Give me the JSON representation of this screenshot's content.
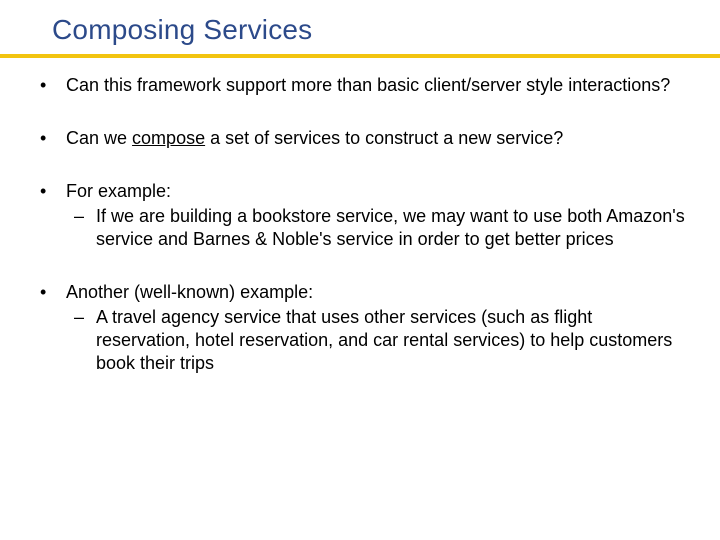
{
  "title": "Composing Services",
  "bullets": {
    "b1": "Can this framework support more than basic client/server style interactions?",
    "b2_pre": "Can we ",
    "b2_u": "compose",
    "b2_post": " a set of services to construct a new service?",
    "b3": "For example:",
    "b3_sub": "If we are building a bookstore service, we may want to use both Amazon's service and Barnes & Noble's service in order to get better prices",
    "b4": "Another (well-known) example:",
    "b4_sub": "A travel agency service that uses other services (such as flight reservation, hotel reservation, and car rental services) to help customers book their trips"
  }
}
